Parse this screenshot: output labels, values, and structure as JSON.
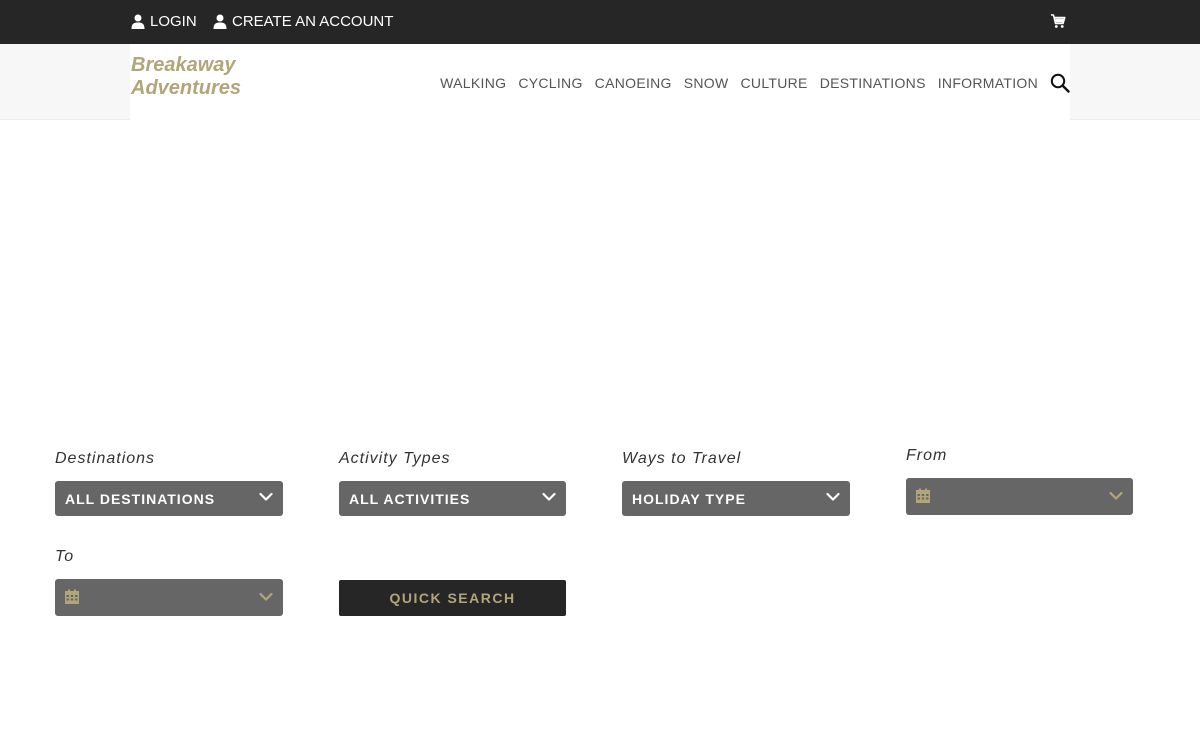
{
  "topbar": {
    "login_label": "LOGIN",
    "create_account_label": "CREATE AN ACCOUNT",
    "icons": {
      "user": "user-icon",
      "cart": "cart-icon"
    }
  },
  "header": {
    "logo_line1": "Breakaway",
    "logo_line2": "Adventures",
    "nav": [
      "WALKING",
      "CYCLING",
      "CANOEING",
      "SNOW",
      "CULTURE",
      "DESTINATIONS",
      "INFORMATION"
    ],
    "search_icon": "search-icon"
  },
  "search_form": {
    "destinations": {
      "label": "Destinations",
      "value": "ALL DESTINATIONS"
    },
    "activity_types": {
      "label": "Activity Types",
      "value": "ALL ACTIVITIES"
    },
    "ways_to_travel": {
      "label": "Ways to Travel",
      "value": "HOLIDAY TYPE"
    },
    "from": {
      "label": "From",
      "value": ""
    },
    "to": {
      "label": "To",
      "value": ""
    },
    "submit_label": "QUICK SEARCH"
  },
  "colors": {
    "dark": "#262626",
    "gold": "#b2a57a",
    "field_bg": "#666666",
    "nav_text": "#555555"
  }
}
